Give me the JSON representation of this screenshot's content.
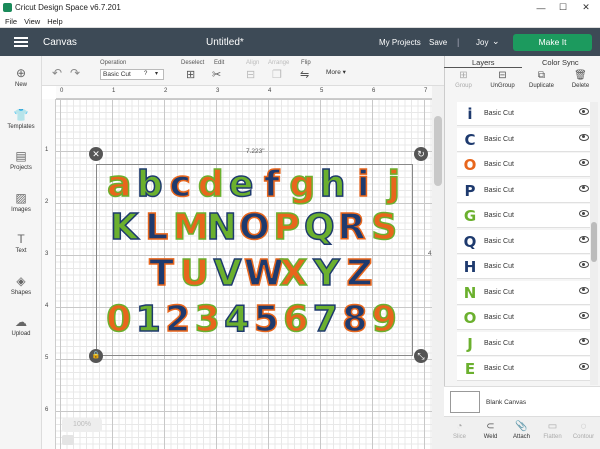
{
  "window": {
    "title": "Cricut Design Space  v6.7.201",
    "min_glyph": "—",
    "max_glyph": "☐",
    "close_glyph": "✕"
  },
  "menubar": {
    "items": [
      "File",
      "View",
      "Help"
    ]
  },
  "header": {
    "page_title": "Canvas",
    "doc_title": "Untitled*",
    "my_projects": "My Projects",
    "save": "Save",
    "separator": "|",
    "user": "Joy",
    "user_chevron": "⌄",
    "make_it": "Make It"
  },
  "toolbar": {
    "operation_label": "Operation",
    "operation_value": "Basic Cut",
    "operation_help": "?",
    "operation_caret": "▾",
    "deselect_label": "Deselect",
    "edit_label": "Edit",
    "align_label": "Align",
    "arrange_label": "Arrange",
    "flip_label": "Flip",
    "more_label": "More ▾",
    "undo_glyph": "↶",
    "redo_glyph": "↷",
    "deselect_glyph": "⊞",
    "edit_glyph": "✂",
    "align_glyph": "⊟",
    "arrange_glyph": "❐",
    "flip_glyph": "⇋"
  },
  "leftbar": {
    "items": [
      {
        "label": "New",
        "icon": "plus-circle-icon",
        "glyph": "⊕"
      },
      {
        "label": "Templates",
        "icon": "shirt-icon",
        "glyph": "👕"
      },
      {
        "label": "Projects",
        "icon": "projects-icon",
        "glyph": "▤"
      },
      {
        "label": "Images",
        "icon": "image-icon",
        "glyph": "▨"
      },
      {
        "label": "Text",
        "icon": "text-icon",
        "glyph": "T"
      },
      {
        "label": "Shapes",
        "icon": "shapes-icon",
        "glyph": "◈"
      },
      {
        "label": "Upload",
        "icon": "upload-icon",
        "glyph": "☁"
      }
    ]
  },
  "rulers": {
    "top": [
      "0",
      "1",
      "2",
      "3",
      "4",
      "5",
      "6",
      "7"
    ],
    "left": [
      "1",
      "2",
      "3",
      "4",
      "5",
      "6"
    ]
  },
  "selection": {
    "width_label": "7.223\"",
    "height_label": "4",
    "delete_glyph": "✕",
    "rotate_glyph": "↻",
    "lock_glyph": "🔒",
    "resize_glyph": "⤡"
  },
  "design": {
    "rows": [
      {
        "text": "abcdefghij",
        "size": 36
      },
      {
        "text": "KLMNOPQRS",
        "size": 36
      },
      {
        "text": "TUVWXYZ",
        "size": 36
      },
      {
        "text": "0123456789",
        "size": 36
      }
    ],
    "palette": {
      "orange": "#e8661c",
      "navy": "#1e3a6e",
      "green": "#6bb02e"
    }
  },
  "zoom": {
    "value": "100%"
  },
  "right_panel": {
    "tabs": [
      "Layers",
      "Color Sync"
    ],
    "actions": [
      {
        "label": "Group",
        "glyph": "⊞",
        "enabled": false
      },
      {
        "label": "UnGroup",
        "glyph": "⊟",
        "enabled": true
      },
      {
        "label": "Duplicate",
        "glyph": "⧉",
        "enabled": true
      },
      {
        "label": "Delete",
        "glyph": "🗑",
        "enabled": true
      }
    ],
    "layers": [
      {
        "glyph": "i",
        "color": "#1e3a6e",
        "label": "Basic Cut"
      },
      {
        "glyph": "C",
        "color": "#1e3a6e",
        "label": "Basic Cut"
      },
      {
        "glyph": "O",
        "color": "#e8661c",
        "label": "Basic Cut"
      },
      {
        "glyph": "P",
        "color": "#1e3a6e",
        "label": "Basic Cut"
      },
      {
        "glyph": "G",
        "color": "#6bb02e",
        "label": "Basic Cut"
      },
      {
        "glyph": "Q",
        "color": "#1e3a6e",
        "label": "Basic Cut"
      },
      {
        "glyph": "H",
        "color": "#1e3a6e",
        "label": "Basic Cut"
      },
      {
        "glyph": "N",
        "color": "#6bb02e",
        "label": "Basic Cut"
      },
      {
        "glyph": "O",
        "color": "#6bb02e",
        "label": "Basic Cut"
      },
      {
        "glyph": "J",
        "color": "#6bb02e",
        "label": "Basic Cut"
      },
      {
        "glyph": "E",
        "color": "#6bb02e",
        "label": "Basic Cut"
      }
    ],
    "blank_canvas": "Blank Canvas",
    "bottom_actions": [
      {
        "label": "Slice",
        "glyph": "◔",
        "enabled": false
      },
      {
        "label": "Weld",
        "glyph": "⊂",
        "enabled": true
      },
      {
        "label": "Attach",
        "glyph": "📎",
        "enabled": true
      },
      {
        "label": "Flatten",
        "glyph": "▭",
        "enabled": false
      },
      {
        "label": "Contour",
        "glyph": "◌",
        "enabled": false
      }
    ]
  }
}
